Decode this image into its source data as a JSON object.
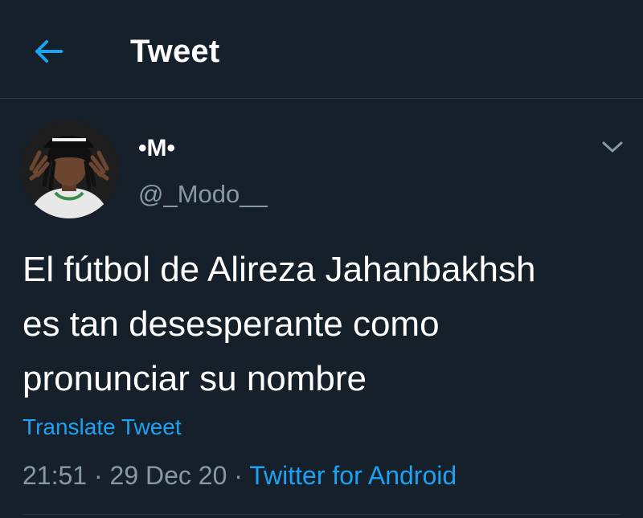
{
  "header": {
    "title": "Tweet",
    "back_icon": "arrow-left-icon"
  },
  "author": {
    "display_name": "•M•",
    "handle": "@_Modo__",
    "avatar_icon": "avatar"
  },
  "tweet": {
    "text": "El fútbol de Alireza Jahanbakhsh\nes tan desesperante como\npronunciar su nombre",
    "translate_label": "Translate Tweet",
    "time": "21:51",
    "separator_1": " · ",
    "date": "29 Dec 20",
    "separator_2": " · ",
    "source": "Twitter for Android"
  },
  "colors": {
    "background": "#15202b",
    "accent": "#1da1f2",
    "secondary_text": "#8899a6",
    "divider": "#2a3744"
  }
}
